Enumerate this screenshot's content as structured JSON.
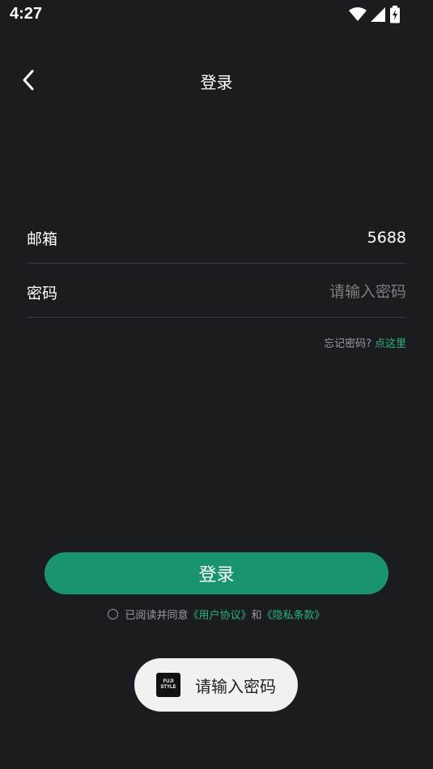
{
  "status_bar": {
    "time": "4:27",
    "icons": [
      "wifi-icon",
      "signal-icon",
      "battery-charging-icon"
    ]
  },
  "header": {
    "back_icon": "chevron-left-icon",
    "title": "登录"
  },
  "form": {
    "email": {
      "label": "邮箱",
      "value": "5688",
      "placeholder": ""
    },
    "password": {
      "label": "密码",
      "value": "",
      "placeholder": "请输入密码"
    }
  },
  "forgot": {
    "prompt": "忘记密码?",
    "link": "点这里"
  },
  "login_button": {
    "label": "登录"
  },
  "agreement": {
    "prefix": "已阅读并同意",
    "user_agreement": "《用户协议》",
    "conjunction": "和",
    "privacy_policy": "《隐私条款》"
  },
  "toast": {
    "logo_line1": "FUJI",
    "logo_line2": "STYLE",
    "message": "请输入密码"
  },
  "colors": {
    "background": "#1b1c20",
    "accent": "#1a9470",
    "link": "#2cb57d",
    "divider": "#3a3b40",
    "muted_text": "#9a9ba0"
  }
}
